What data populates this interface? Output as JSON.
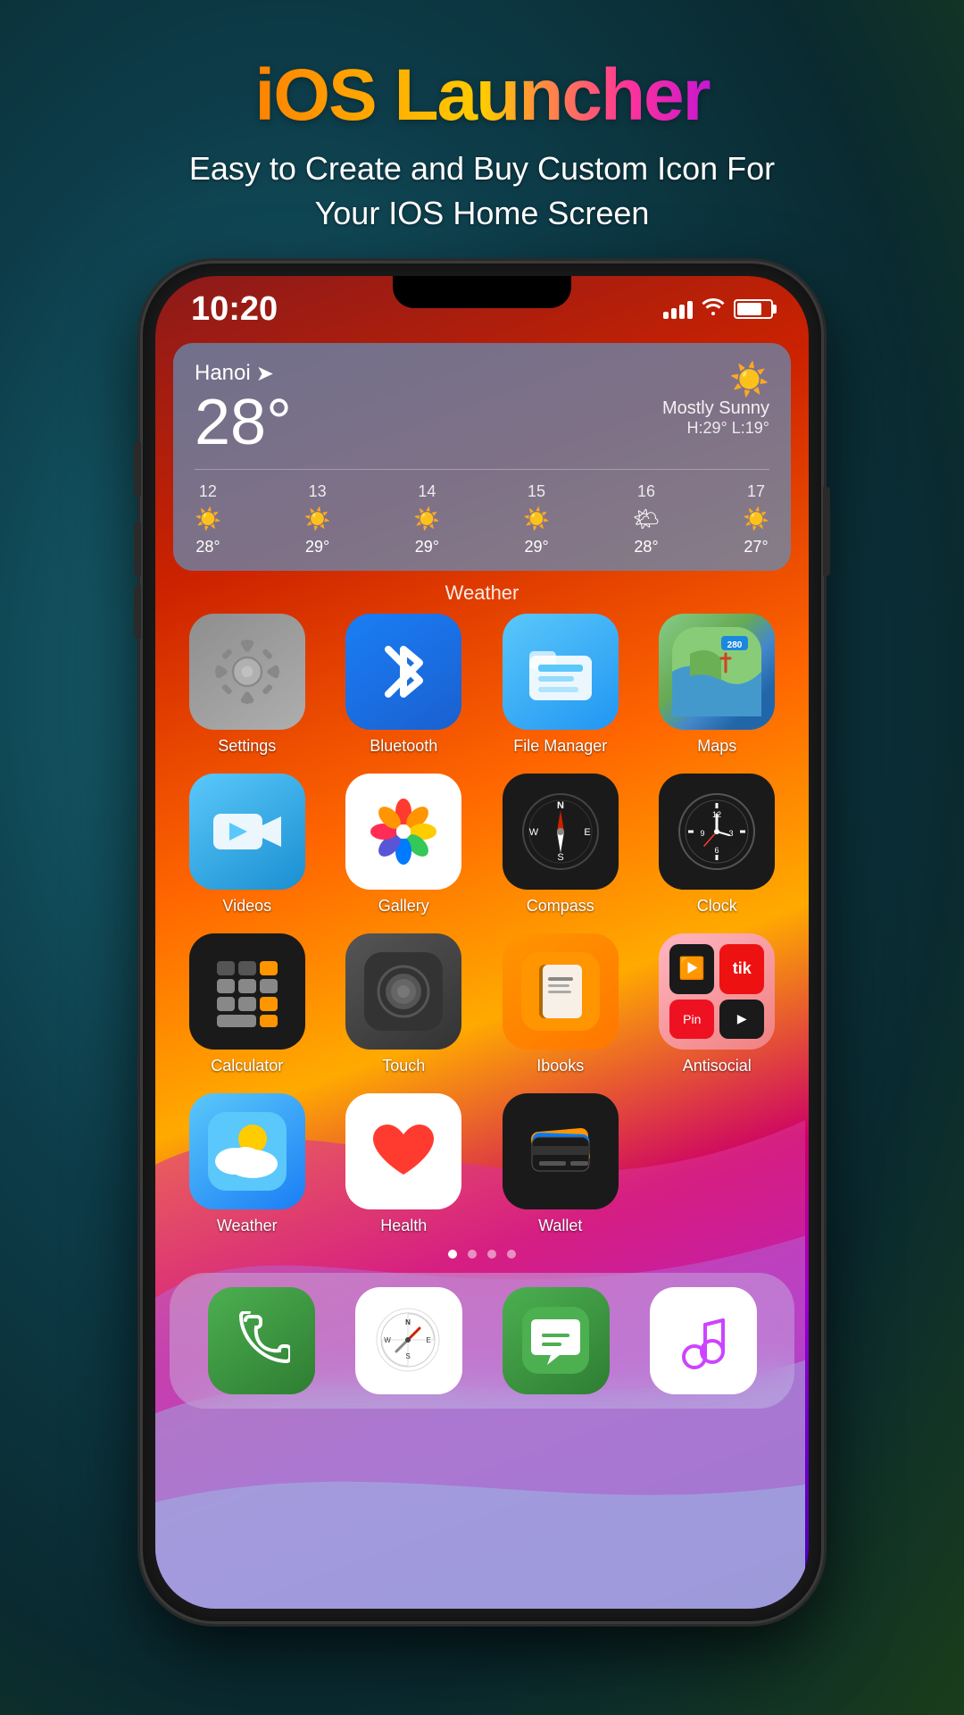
{
  "header": {
    "title": "iOS Launcher",
    "subtitle": "Easy to Create and Buy Custom Icon For\nYour IOS Home Screen"
  },
  "statusBar": {
    "time": "10:20",
    "battery": "75"
  },
  "weatherWidget": {
    "city": "Hanoi",
    "temperature": "28°",
    "condition": "Mostly Sunny",
    "high": "29°",
    "low": "19°",
    "forecast": [
      {
        "day": "12",
        "icon": "☀️",
        "temp": "28°"
      },
      {
        "day": "13",
        "icon": "☀️",
        "temp": "29°"
      },
      {
        "day": "14",
        "icon": "☀️",
        "temp": "29°"
      },
      {
        "day": "15",
        "icon": "☀️",
        "temp": "29°"
      },
      {
        "day": "16",
        "icon": "🌤",
        "temp": "28°"
      },
      {
        "day": "17",
        "icon": "☀️",
        "temp": "27°"
      }
    ]
  },
  "sectionLabel": "Weather",
  "apps": [
    {
      "id": "settings",
      "label": "Settings"
    },
    {
      "id": "bluetooth",
      "label": "Bluetooth"
    },
    {
      "id": "filemanager",
      "label": "File Manager"
    },
    {
      "id": "maps",
      "label": "Maps"
    },
    {
      "id": "videos",
      "label": "Videos"
    },
    {
      "id": "gallery",
      "label": "Gallery"
    },
    {
      "id": "compass",
      "label": "Compass"
    },
    {
      "id": "clock",
      "label": "Clock"
    },
    {
      "id": "calculator",
      "label": "Calculator"
    },
    {
      "id": "touch",
      "label": "Touch"
    },
    {
      "id": "ibooks",
      "label": "Ibooks"
    },
    {
      "id": "antisocial",
      "label": "Antisocial"
    },
    {
      "id": "weather",
      "label": "Weather"
    },
    {
      "id": "health",
      "label": "Health"
    },
    {
      "id": "wallet",
      "label": "Wallet"
    }
  ],
  "pageDots": [
    true,
    false,
    false,
    false
  ],
  "dock": [
    {
      "id": "phone",
      "label": "Phone"
    },
    {
      "id": "safari",
      "label": "Safari"
    },
    {
      "id": "messages",
      "label": "Messages"
    },
    {
      "id": "music",
      "label": "Music"
    }
  ]
}
